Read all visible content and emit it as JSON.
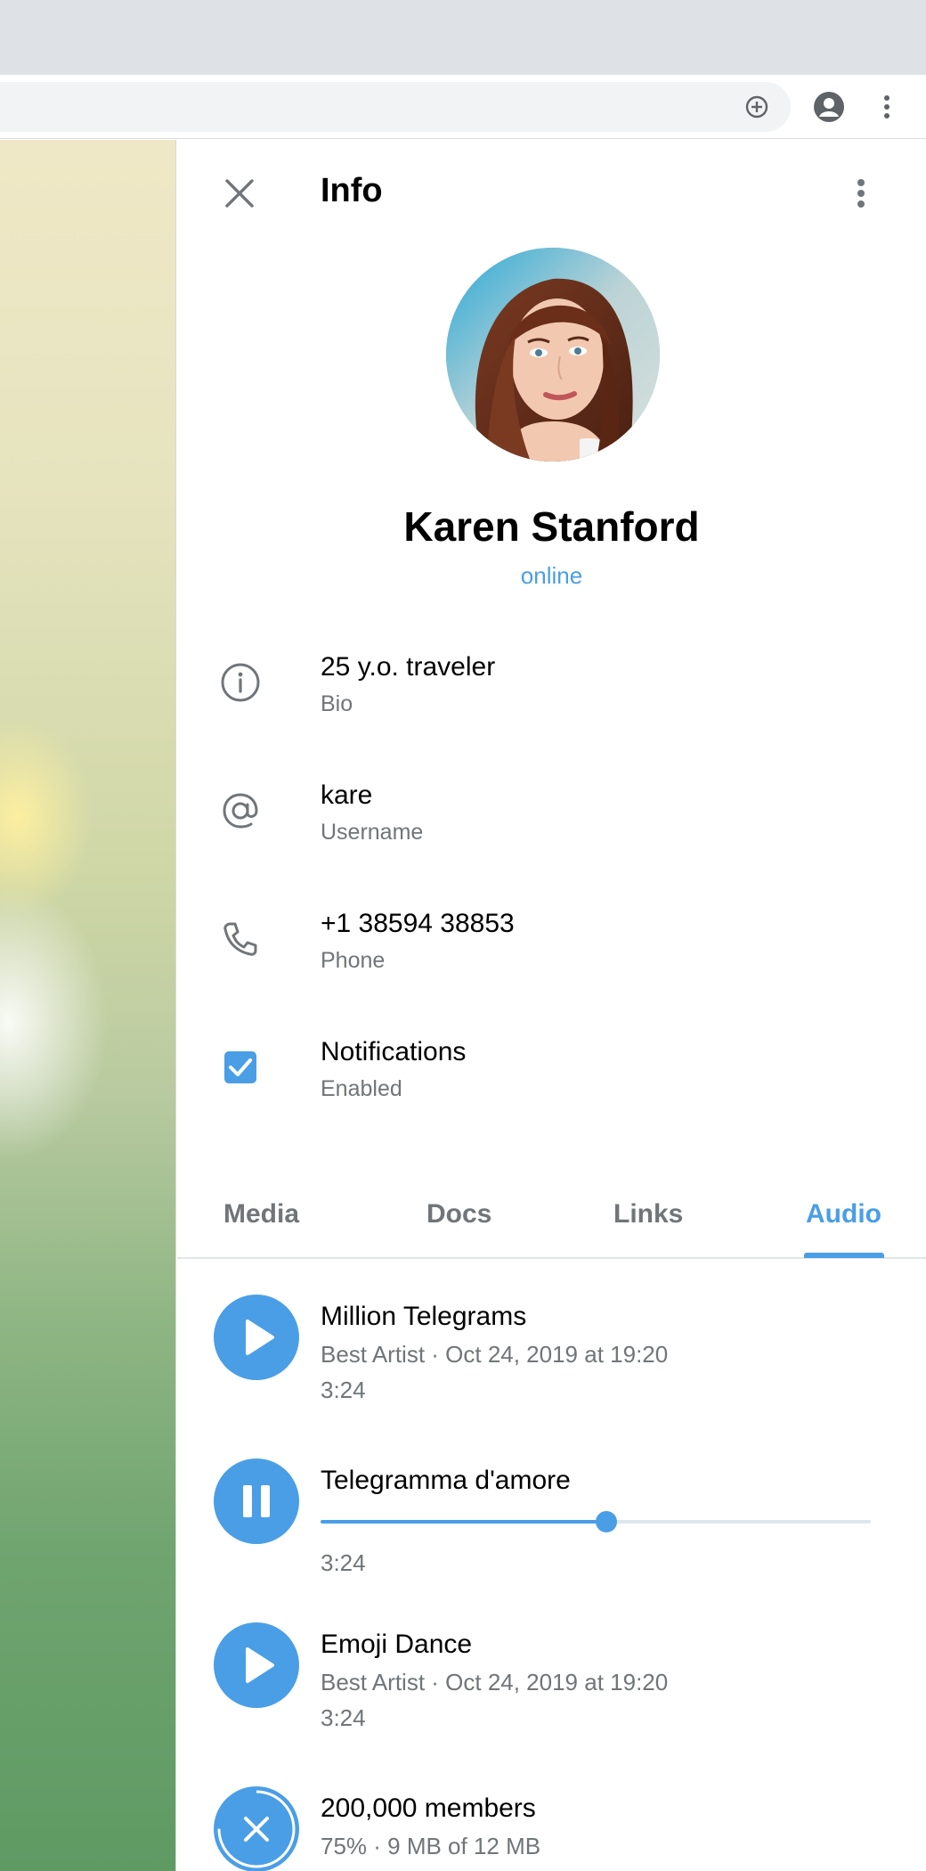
{
  "colors": {
    "accent": "#4a9ee6",
    "secondary_text": "#707579",
    "chrome_bg": "#dee1e6"
  },
  "browser": {
    "icons": [
      "add-circle-icon",
      "account-icon",
      "more-vertical-icon"
    ]
  },
  "header": {
    "title": "Info",
    "icons": [
      "close-icon",
      "more-vertical-icon"
    ]
  },
  "profile": {
    "name": "Karen Stanford",
    "status": "online"
  },
  "info": [
    {
      "icon": "info-icon",
      "value": "25 y.o. traveler",
      "label": "Bio"
    },
    {
      "icon": "at-sign-icon",
      "value": "kare",
      "label": "Username"
    },
    {
      "icon": "phone-icon",
      "value": "+1 38594 38853",
      "label": "Phone"
    },
    {
      "icon": "checkbox-checked-icon",
      "value": "Notifications",
      "label": "Enabled"
    }
  ],
  "tabs": [
    {
      "label": "Media",
      "active": false
    },
    {
      "label": "Docs",
      "active": false
    },
    {
      "label": "Links",
      "active": false
    },
    {
      "label": "Audio",
      "active": true
    }
  ],
  "audio": [
    {
      "icon": "play-icon",
      "title": "Million Telegrams",
      "meta": "Best Artist · Oct 24, 2019 at 19:20",
      "duration": "3:24"
    },
    {
      "icon": "pause-icon",
      "title": "Telegramma d'amore",
      "duration": "3:24",
      "progress": 0.52
    },
    {
      "icon": "play-icon",
      "title": "Emoji Dance",
      "meta": "Best Artist · Oct 24, 2019 at 19:20",
      "duration": "3:24"
    },
    {
      "icon": "cancel-download-icon",
      "title": "200,000 members",
      "meta": "75% · 9 MB of 12 MB",
      "download_progress": 0.75
    }
  ]
}
